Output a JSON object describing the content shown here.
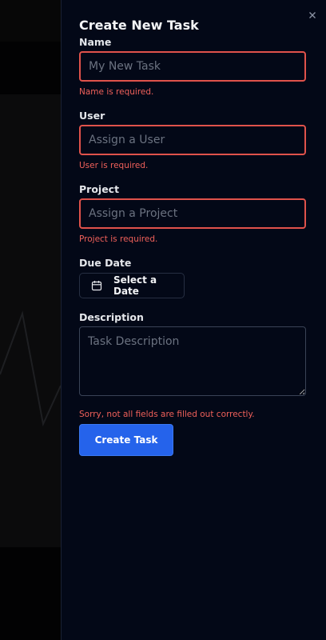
{
  "panel": {
    "title": "Create New Task",
    "close_icon": "close-icon"
  },
  "form": {
    "name": {
      "label": "Name",
      "placeholder": "My New Task",
      "value": "",
      "error": "Name is required."
    },
    "user": {
      "label": "User",
      "placeholder": "Assign a User",
      "value": "",
      "error": "User is required."
    },
    "project": {
      "label": "Project",
      "placeholder": "Assign a Project",
      "value": "",
      "error": "Project is required."
    },
    "due_date": {
      "label": "Due Date",
      "button_label": "Select a Date",
      "icon": "calendar-icon"
    },
    "description": {
      "label": "Description",
      "placeholder": "Task Description",
      "value": ""
    },
    "form_error": "Sorry, not all fields are filled out correctly.",
    "submit_label": "Create Task"
  },
  "colors": {
    "panel_bg": "#030817",
    "error": "#f0605a",
    "error_border": "#e0524b",
    "primary": "#2563eb"
  }
}
